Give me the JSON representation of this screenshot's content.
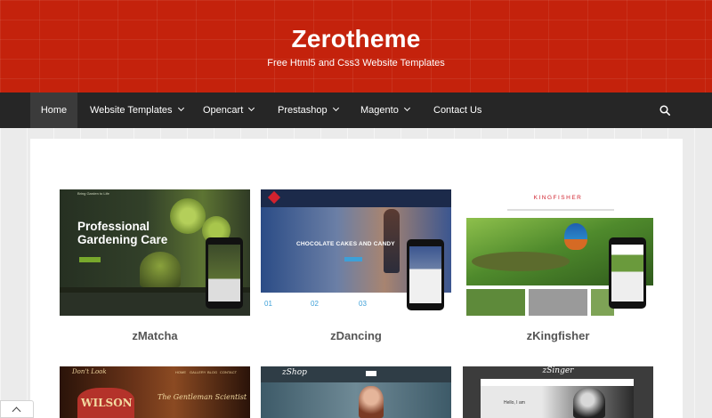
{
  "header": {
    "title": "Zerotheme",
    "tagline": "Free Html5 and Css3 Website Templates"
  },
  "nav": {
    "items": [
      {
        "label": "Home",
        "active": true,
        "dropdown": false
      },
      {
        "label": "Website Templates",
        "dropdown": true
      },
      {
        "label": "Opencart",
        "dropdown": true
      },
      {
        "label": "Prestashop",
        "dropdown": true
      },
      {
        "label": "Magento",
        "dropdown": true
      },
      {
        "label": "Contact Us",
        "dropdown": false
      }
    ],
    "search_icon": "search-icon"
  },
  "cards": [
    {
      "title": "zMatcha",
      "hero": "Professional Gardening Care",
      "sub": "Bring Garden to Life"
    },
    {
      "title": "zDancing",
      "hero": "CHOCOLATE CAKES AND CANDY",
      "stats": [
        "01",
        "02",
        "03"
      ]
    },
    {
      "title": "zKingfisher",
      "brand": "KINGFISHER"
    },
    {
      "title": "",
      "brand": "Don't Look",
      "sign": "WILSON",
      "caption": "The Gentleman Scientist",
      "menu": [
        "HOME",
        "GALLERY",
        "BLOG",
        "CONTACT"
      ]
    },
    {
      "title": "",
      "brand": "zShop"
    },
    {
      "title": "",
      "brand": "zSinger",
      "caption": "Hello, I am"
    }
  ],
  "colors": {
    "header_red": "#c4220c",
    "nav_bg": "#262626",
    "title_gray": "#555555"
  }
}
